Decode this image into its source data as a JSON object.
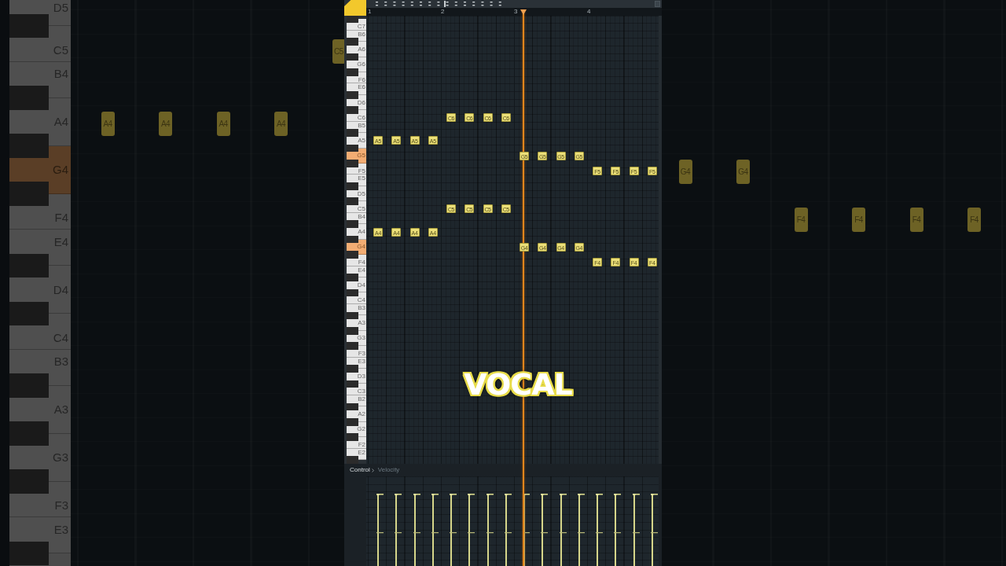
{
  "background_roll": {
    "keys": [
      {
        "label": "D5",
        "highlighted": false
      },
      {
        "label": "C5",
        "highlighted": false
      },
      {
        "label": "B4",
        "highlighted": false
      },
      {
        "label": "A4",
        "highlighted": false
      },
      {
        "label": "G4",
        "highlighted": true
      },
      {
        "label": "F4",
        "highlighted": false
      },
      {
        "label": "E4",
        "highlighted": false
      },
      {
        "label": "D4",
        "highlighted": false
      },
      {
        "label": "C4",
        "highlighted": false
      },
      {
        "label": "B3",
        "highlighted": false
      },
      {
        "label": "A3",
        "highlighted": false
      },
      {
        "label": "G3",
        "highlighted": false
      },
      {
        "label": "F3",
        "highlighted": false
      },
      {
        "label": "E3",
        "highlighted": false
      }
    ],
    "notes": [
      {
        "label": "C5"
      },
      {
        "label": "A4"
      },
      {
        "label": "A4"
      },
      {
        "label": "A4"
      },
      {
        "label": "A4"
      },
      {
        "label": "G4"
      },
      {
        "label": "G4"
      },
      {
        "label": "F4"
      },
      {
        "label": "F4"
      },
      {
        "label": "F4"
      },
      {
        "label": "F4"
      }
    ]
  },
  "piano_roll": {
    "ruler": [
      "1",
      "2",
      "3",
      "4"
    ],
    "keys": [
      {
        "label": "C7",
        "highlighted": false
      },
      {
        "label": "B6",
        "highlighted": false
      },
      {
        "label": "A6",
        "highlighted": false
      },
      {
        "label": "G6",
        "highlighted": false
      },
      {
        "label": "F6",
        "highlighted": false
      },
      {
        "label": "E6",
        "highlighted": false
      },
      {
        "label": "D6",
        "highlighted": false
      },
      {
        "label": "C6",
        "highlighted": false
      },
      {
        "label": "B5",
        "highlighted": false
      },
      {
        "label": "A5",
        "highlighted": false
      },
      {
        "label": "G5",
        "highlighted": true
      },
      {
        "label": "F5",
        "highlighted": false
      },
      {
        "label": "E5",
        "highlighted": false
      },
      {
        "label": "D5",
        "highlighted": false
      },
      {
        "label": "C5",
        "highlighted": false
      },
      {
        "label": "B4",
        "highlighted": false
      },
      {
        "label": "A4",
        "highlighted": false
      },
      {
        "label": "G4",
        "highlighted": true
      },
      {
        "label": "F4",
        "highlighted": false
      },
      {
        "label": "E4",
        "highlighted": false
      },
      {
        "label": "D4",
        "highlighted": false
      },
      {
        "label": "C4",
        "highlighted": false
      },
      {
        "label": "B3",
        "highlighted": false
      },
      {
        "label": "A3",
        "highlighted": false
      },
      {
        "label": "G3",
        "highlighted": false
      },
      {
        "label": "F3",
        "highlighted": false
      },
      {
        "label": "E3",
        "highlighted": false
      },
      {
        "label": "D3",
        "highlighted": false
      },
      {
        "label": "C3",
        "highlighted": false
      },
      {
        "label": "B2",
        "highlighted": false
      },
      {
        "label": "A2",
        "highlighted": false
      },
      {
        "label": "G2",
        "highlighted": false
      },
      {
        "label": "F2",
        "highlighted": false
      },
      {
        "label": "E2",
        "highlighted": false
      }
    ],
    "notes": [
      {
        "label": "C6"
      },
      {
        "label": "C6"
      },
      {
        "label": "C6"
      },
      {
        "label": "C6"
      },
      {
        "label": "A5"
      },
      {
        "label": "A5"
      },
      {
        "label": "A5"
      },
      {
        "label": "A5"
      },
      {
        "label": "G5"
      },
      {
        "label": "G5"
      },
      {
        "label": "G5"
      },
      {
        "label": "G5"
      },
      {
        "label": "F5"
      },
      {
        "label": "F5"
      },
      {
        "label": "F5"
      },
      {
        "label": "F5"
      },
      {
        "label": "C5"
      },
      {
        "label": "C5"
      },
      {
        "label": "C5"
      },
      {
        "label": "C5"
      },
      {
        "label": "A4"
      },
      {
        "label": "A4"
      },
      {
        "label": "A4"
      },
      {
        "label": "A4"
      },
      {
        "label": "G4"
      },
      {
        "label": "G4"
      },
      {
        "label": "G4"
      },
      {
        "label": "G4"
      },
      {
        "label": "F4"
      },
      {
        "label": "F4"
      },
      {
        "label": "F4"
      },
      {
        "label": "F4"
      }
    ],
    "control_pane": {
      "selector": "Control",
      "parameter": "Velocity"
    }
  },
  "caption": "VOCAL"
}
